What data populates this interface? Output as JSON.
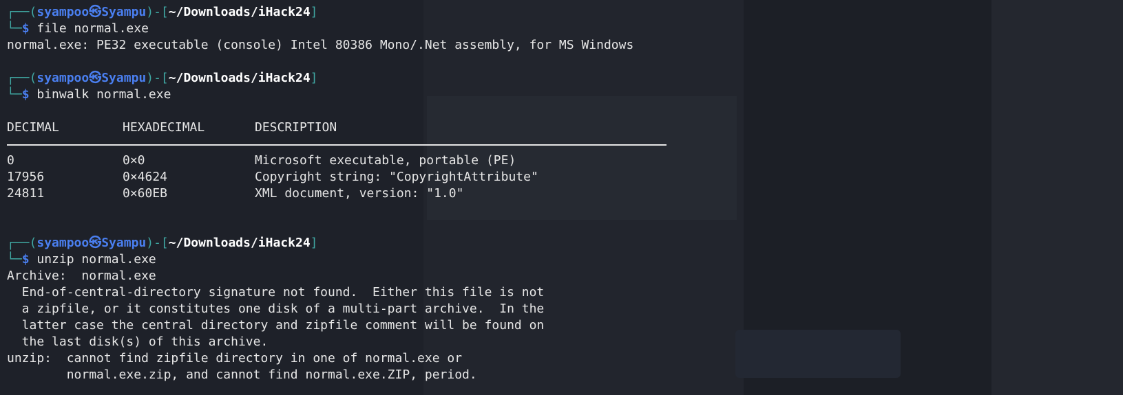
{
  "prompt": {
    "corner_top": "┌──(",
    "user": "syampoo",
    "skull": "㉿",
    "host": "Syampu",
    "mid": ")-[",
    "path": "~/Downloads/iHack24",
    "close": "]",
    "corner_bottom": "└─",
    "dollar": "$"
  },
  "blocks": {
    "file": {
      "command": "file normal.exe",
      "output": "normal.exe: PE32 executable (console) Intel 80386 Mono/.Net assembly, for MS Windows"
    },
    "binwalk": {
      "command": "binwalk normal.exe",
      "headers": [
        "DECIMAL",
        "HEXADECIMAL",
        "DESCRIPTION"
      ],
      "rows": [
        [
          "0",
          "0×0",
          "Microsoft executable, portable (PE)"
        ],
        [
          "17956",
          "0×4624",
          "Copyright string: \"CopyrightAttribute\""
        ],
        [
          "24811",
          "0×60EB",
          "XML document, version: \"1.0\""
        ]
      ]
    },
    "unzip": {
      "command": "unzip normal.exe",
      "output": [
        "Archive:  normal.exe",
        "  End-of-central-directory signature not found.  Either this file is not",
        "  a zipfile, or it constitutes one disk of a multi-part archive.  In the",
        "  latter case the central directory and zipfile comment will be found on",
        "  the last disk(s) of this archive.",
        "unzip:  cannot find zipfile directory in one of normal.exe or",
        "        normal.exe.zip, and cannot find normal.exe.ZIP, period."
      ]
    }
  }
}
